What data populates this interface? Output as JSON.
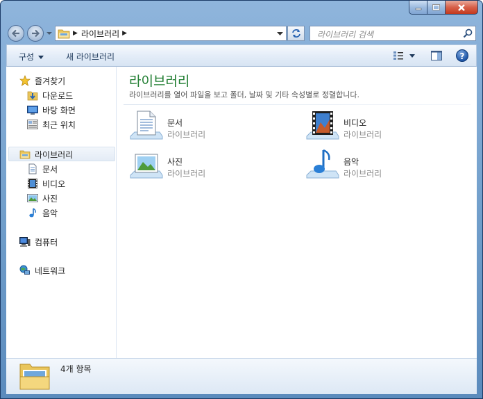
{
  "window": {
    "caption_buttons": [
      "minimize-icon",
      "maximize-icon",
      "close-icon"
    ]
  },
  "address": {
    "path": "라이브러리",
    "icons": [
      "back-arrow-icon",
      "forward-arrow-icon",
      "refresh-icon"
    ]
  },
  "search": {
    "placeholder": "라이브러리 검색"
  },
  "commands": {
    "organize": "구성",
    "new_library": "새 라이브러리"
  },
  "sidebar": {
    "favorites": {
      "label": "즐겨찾기",
      "items": [
        {
          "label": "다운로드",
          "icon": "download-folder-icon"
        },
        {
          "label": "바탕 화면",
          "icon": "desktop-icon"
        },
        {
          "label": "최근 위치",
          "icon": "recent-places-icon"
        }
      ]
    },
    "libraries": {
      "label": "라이브러리",
      "items": [
        {
          "label": "문서",
          "icon": "document-icon"
        },
        {
          "label": "비디오",
          "icon": "video-icon"
        },
        {
          "label": "사진",
          "icon": "picture-icon"
        },
        {
          "label": "음악",
          "icon": "music-icon"
        }
      ]
    },
    "computer": {
      "label": "컴퓨터"
    },
    "network": {
      "label": "네트워크"
    }
  },
  "main": {
    "title": "라이브러리",
    "description": "라이브러리를 열어 파일을 보고 폴더, 날짜 및 기타 속성별로 정렬합니다.",
    "libraries": [
      {
        "name": "문서",
        "type": "라이브러리",
        "icon": "documents-library-icon"
      },
      {
        "name": "비디오",
        "type": "라이브러리",
        "icon": "videos-library-icon"
      },
      {
        "name": "사진",
        "type": "라이브러리",
        "icon": "pictures-library-icon"
      },
      {
        "name": "음악",
        "type": "라이브러리",
        "icon": "music-library-icon"
      }
    ]
  },
  "details": {
    "count": "4개 항목"
  },
  "colors": {
    "title_green": "#1e7c2f",
    "frame_blue": "#6e9cc9",
    "subtext_gray": "#8a8a8a"
  }
}
